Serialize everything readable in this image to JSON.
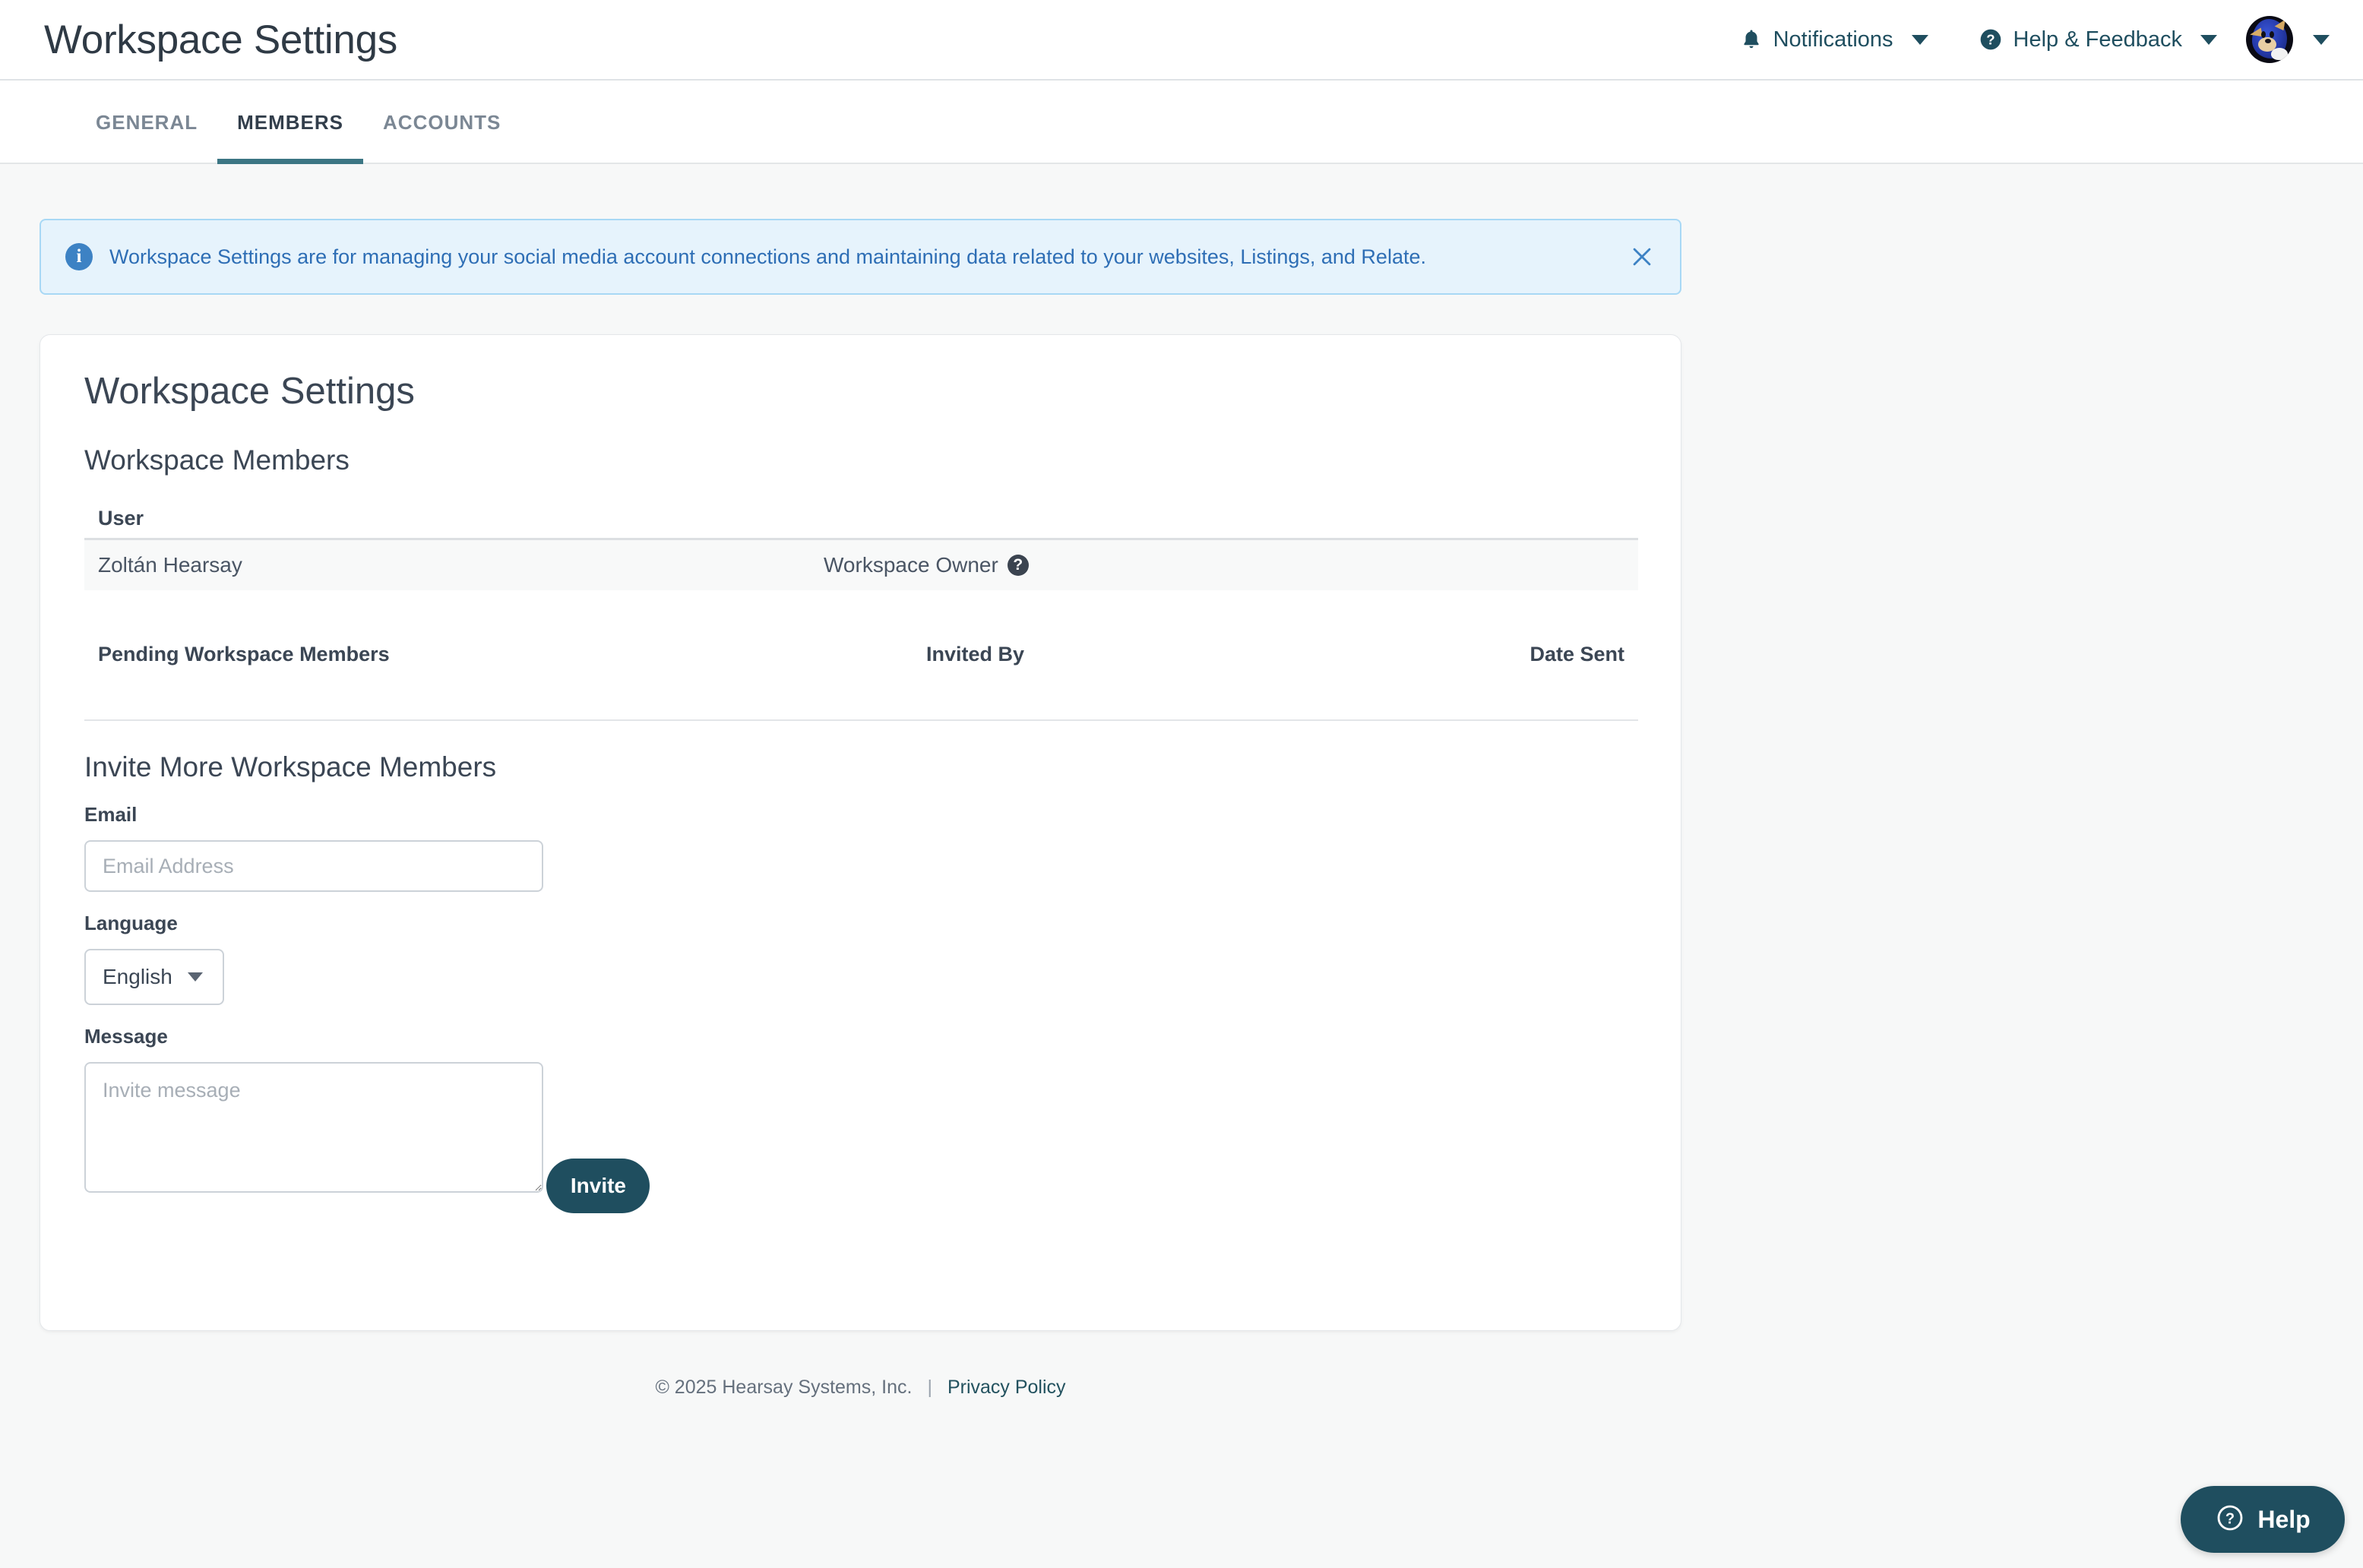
{
  "header": {
    "title": "Workspace Settings",
    "notifications_label": "Notifications",
    "help_feedback_label": "Help & Feedback"
  },
  "tabs": [
    {
      "label": "GENERAL",
      "active": false
    },
    {
      "label": "MEMBERS",
      "active": true
    },
    {
      "label": "ACCOUNTS",
      "active": false
    }
  ],
  "banner": {
    "icon": "info-icon",
    "text": "Workspace Settings are for managing your social media account connections and maintaining data related to your websites, Listings, and Relate.",
    "close_icon": "close-icon",
    "background": "#e6f3fc",
    "border": "#a8d8f5",
    "text_color": "#2e6eb5"
  },
  "card": {
    "title": "Workspace Settings",
    "members_section": {
      "heading": "Workspace Members",
      "columns": [
        "User"
      ],
      "rows": [
        {
          "name": "Zoltán Hearsay",
          "role": "Workspace Owner",
          "role_help": "?"
        }
      ]
    },
    "pending_section": {
      "columns": [
        "Pending Workspace Members",
        "Invited By",
        "Date Sent"
      ],
      "rows": []
    },
    "invite_section": {
      "heading": "Invite More Workspace Members",
      "email_label": "Email",
      "email_value": "",
      "email_placeholder": "Email Address",
      "language_label": "Language",
      "language_value": "English",
      "message_label": "Message",
      "message_value": "",
      "message_placeholder": "Invite message",
      "invite_button": "Invite"
    }
  },
  "footer": {
    "copyright": "© 2025 Hearsay Systems, Inc.",
    "separator": "|",
    "privacy_link": "Privacy Policy"
  },
  "help_widget": {
    "label": "Help",
    "icon": "question-circle-icon",
    "color": "#1f4e5f"
  }
}
